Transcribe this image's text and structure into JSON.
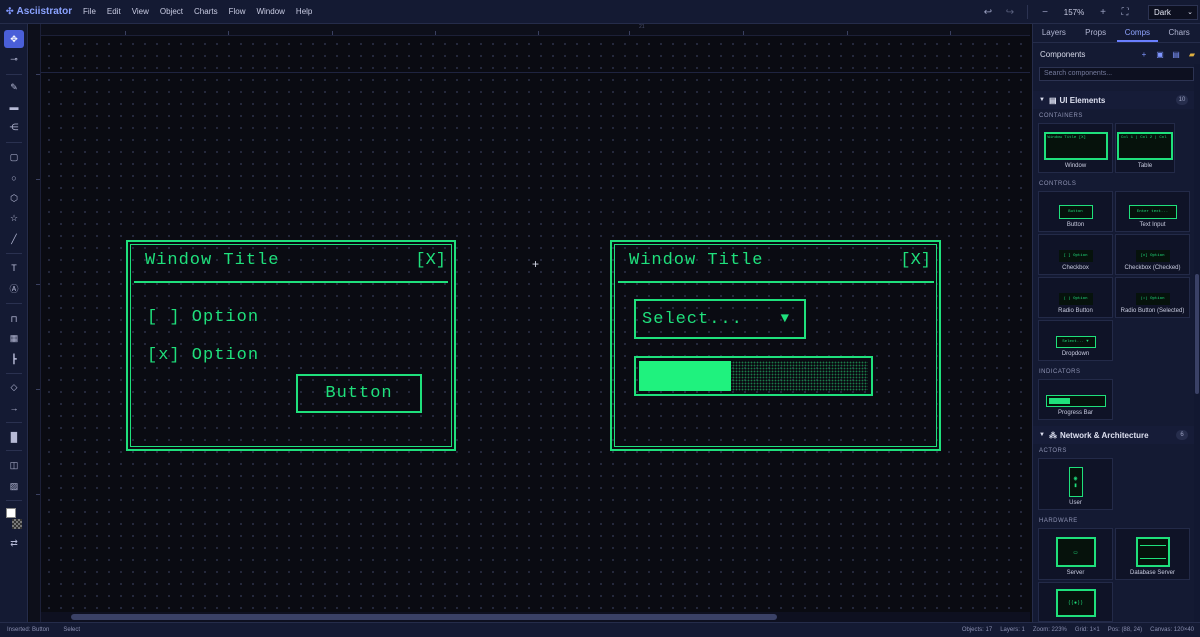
{
  "app": {
    "name": "Asciistrator"
  },
  "menu": [
    "File",
    "Edit",
    "View",
    "Object",
    "Charts",
    "Flow",
    "Window",
    "Help"
  ],
  "toolbar": {
    "zoom": "157%",
    "theme": "Dark"
  },
  "ruler": {
    "mark": "21"
  },
  "canvas": {
    "window1": {
      "title": "Window Title",
      "close": "[X]",
      "option1": "[ ] Option",
      "option2": "[x] Option",
      "button": "Button"
    },
    "window2": {
      "title": "Window Title",
      "close": "[X]",
      "select_text": "Select...",
      "select_arrow": "▼",
      "progress": 0.4
    }
  },
  "panel": {
    "tabs": [
      "Layers",
      "Props",
      "Comps",
      "Chars"
    ],
    "active_tab": "Comps",
    "header": "Components",
    "search_placeholder": "Search components...",
    "groups": [
      {
        "name": "UI Elements",
        "count": "10",
        "sections": [
          {
            "label": "CONTAINERS",
            "items": [
              {
                "label": "Window",
                "preview": "Window Title      [X]"
              },
              {
                "label": "Table",
                "preview": "Col 1 | Col 2 | Col"
              }
            ]
          },
          {
            "label": "CONTROLS",
            "items": [
              {
                "label": "Button",
                "preview": "Button"
              },
              {
                "label": "Text Input",
                "preview": "Enter text..."
              },
              {
                "label": "Checkbox",
                "preview": "[ ] Option"
              },
              {
                "label": "Checkbox (Checked)",
                "preview": "[x] Option"
              },
              {
                "label": "Radio Button",
                "preview": "( ) Option"
              },
              {
                "label": "Radio Button (Selected)",
                "preview": "(•) Option"
              },
              {
                "label": "Dropdown",
                "preview": "Select... ▼"
              }
            ]
          },
          {
            "label": "INDICATORS",
            "items": [
              {
                "label": "Progress Bar",
                "preview": ""
              }
            ]
          }
        ]
      },
      {
        "name": "Network & Architecture",
        "count": "6",
        "sections": [
          {
            "label": "ACTORS",
            "items": [
              {
                "label": "User",
                "preview": ""
              }
            ]
          },
          {
            "label": "HARDWARE",
            "items": [
              {
                "label": "Server",
                "preview": "▭"
              },
              {
                "label": "Database Server",
                "preview": ""
              },
              {
                "label": "",
                "preview": "((●))"
              }
            ]
          }
        ]
      }
    ]
  },
  "status": {
    "left": [
      "Inserted: Button",
      "Select"
    ],
    "right": [
      "Objects: 17",
      "Layers: 1",
      "Zoom: 223%",
      "Grid: 1×1",
      "Pos: (88, 24)",
      "Canvas: 120×40"
    ]
  },
  "colors": {
    "accent": "#6a7fff",
    "ascii_green": "#1fe07c",
    "canvas_bg": "#0a0b12",
    "panel_bg": "#141a33"
  },
  "icons": [
    "select-icon",
    "direct-select-icon",
    "pencil-icon",
    "brush-icon",
    "spray-icon",
    "rectangle-icon",
    "ellipse-icon",
    "polygon-icon",
    "star-icon",
    "line-icon",
    "text-icon",
    "text-path-icon",
    "table-icon",
    "pattern-icon",
    "connector-icon",
    "node-icon",
    "arrow-icon",
    "fill-icon",
    "split-icon",
    "grid-icon",
    "swap-colors-icon"
  ]
}
